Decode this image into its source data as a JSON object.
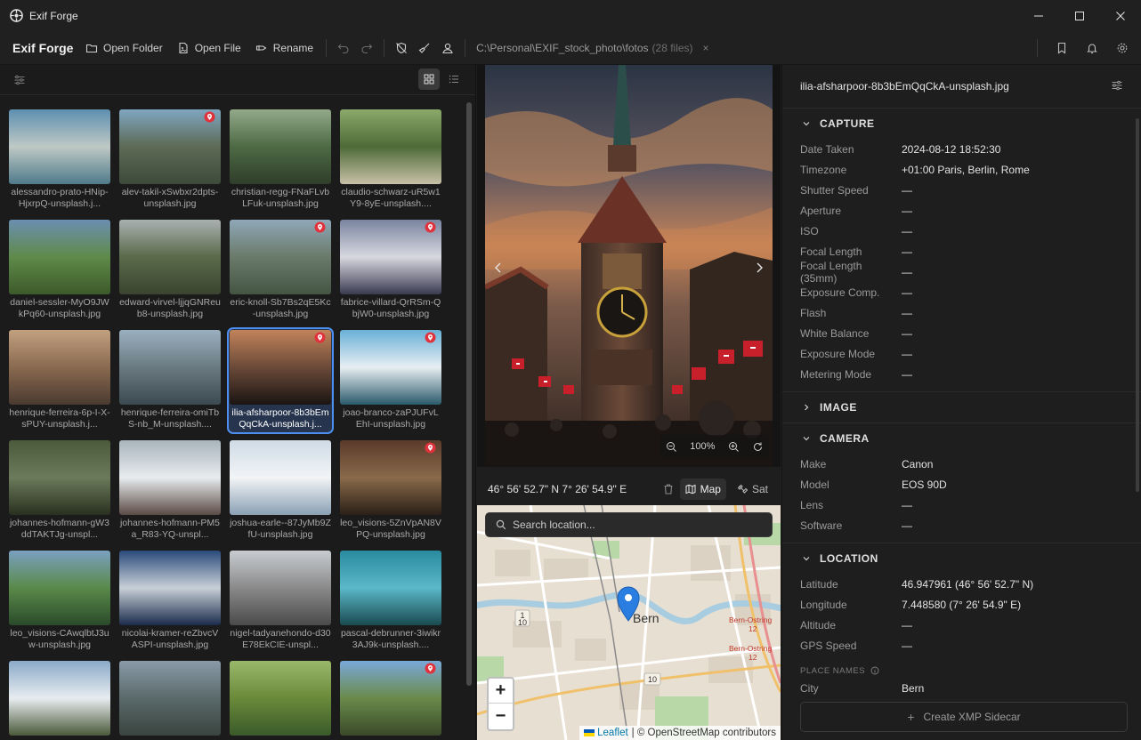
{
  "window": {
    "title": "Exif Forge"
  },
  "toolbar": {
    "brand": "Exif Forge",
    "open_folder": "Open Folder",
    "open_file": "Open File",
    "rename": "Rename",
    "path": "C:\\Personal\\EXIF_stock_photo\\fotos",
    "count": "(28 files)",
    "close_glyph": "×"
  },
  "grid": {
    "items": [
      {
        "name": "alessandro-prato-HNip-HjxrpQ-unsplash.j...",
        "pin": false
      },
      {
        "name": "alev-takil-xSwbxr2dpts-unsplash.jpg",
        "pin": true
      },
      {
        "name": "christian-regg-FNaFLvbLFuk-unsplash.jpg",
        "pin": false
      },
      {
        "name": "claudio-schwarz-uR5w1Y9-8yE-unsplash....",
        "pin": false
      },
      {
        "name": "daniel-sessler-MyO9JWkPq60-unsplash.jpg",
        "pin": false
      },
      {
        "name": "edward-virvel-ljjqGNReub8-unsplash.jpg",
        "pin": false
      },
      {
        "name": "eric-knoll-Sb7Bs2qE5Kc-unsplash.jpg",
        "pin": true
      },
      {
        "name": "fabrice-villard-QrRSm-QbjW0-unsplash.jpg",
        "pin": true
      },
      {
        "name": "henrique-ferreira-6p-I-X-sPUY-unsplash.j...",
        "pin": false
      },
      {
        "name": "henrique-ferreira-omiTbS-nb_M-unsplash....",
        "pin": false
      },
      {
        "name": "ilia-afsharpoor-8b3bEmQqCkA-unsplash.j...",
        "pin": true,
        "selected": true
      },
      {
        "name": "joao-branco-zaPJUFvLEhI-unsplash.jpg",
        "pin": true
      },
      {
        "name": "johannes-hofmann-gW3ddTAKTJg-unspl...",
        "pin": false
      },
      {
        "name": "johannes-hofmann-PM5a_R83-YQ-unspl...",
        "pin": false
      },
      {
        "name": "joshua-earle--87JyMb9ZfU-unsplash.jpg",
        "pin": false
      },
      {
        "name": "leo_visions-5ZnVpAN8VPQ-unsplash.jpg",
        "pin": true
      },
      {
        "name": "leo_visions-CAwqlbtJ3uw-unsplash.jpg",
        "pin": false
      },
      {
        "name": "nicolai-kramer-reZbvcVASPI-unsplash.jpg",
        "pin": false
      },
      {
        "name": "nigel-tadyanehondo-d30E78EkCIE-unspl...",
        "pin": false
      },
      {
        "name": "pascal-debrunner-3iwikr3AJ9k-unsplash....",
        "pin": false
      },
      {
        "name": "",
        "pin": false
      },
      {
        "name": "",
        "pin": false
      },
      {
        "name": "",
        "pin": false
      },
      {
        "name": "",
        "pin": true
      }
    ]
  },
  "viewer": {
    "zoom": "100%"
  },
  "coords": {
    "text": "46° 56' 52.7\" N 7° 26' 54.9\" E",
    "map_label": "Map",
    "sat_label": "Sat"
  },
  "map": {
    "search_placeholder": "Search location...",
    "city_label": "Bern",
    "zoom_in": "+",
    "zoom_out": "−",
    "leaflet": "Leaflet",
    "attribution": "| © OpenStreetMap contributors",
    "road_labels": [
      "1",
      "10",
      "10",
      "Bern-Ostring",
      "Bern-Ostring",
      "12",
      "12"
    ]
  },
  "details": {
    "filename": "ilia-afsharpoor-8b3bEmQqCkA-unsplash.jpg",
    "capture": {
      "title": "CAPTURE",
      "rows": [
        {
          "k": "Date Taken",
          "v": "2024-08-12  18:52:30"
        },
        {
          "k": "Timezone",
          "v": "+01:00 Paris, Berlin, Rome"
        },
        {
          "k": "Shutter Speed",
          "v": "—"
        },
        {
          "k": "Aperture",
          "v": "—"
        },
        {
          "k": "ISO",
          "v": "—"
        },
        {
          "k": "Focal Length",
          "v": "—"
        },
        {
          "k": "Focal Length (35mm)",
          "v": "—"
        },
        {
          "k": "Exposure Comp.",
          "v": "—"
        },
        {
          "k": "Flash",
          "v": "—"
        },
        {
          "k": "White Balance",
          "v": "—"
        },
        {
          "k": "Exposure Mode",
          "v": "—"
        },
        {
          "k": "Metering Mode",
          "v": "—"
        }
      ]
    },
    "image": {
      "title": "IMAGE"
    },
    "camera": {
      "title": "CAMERA",
      "rows": [
        {
          "k": "Make",
          "v": "Canon"
        },
        {
          "k": "Model",
          "v": "EOS 90D"
        },
        {
          "k": "Lens",
          "v": "—"
        },
        {
          "k": "Software",
          "v": "—"
        }
      ]
    },
    "location": {
      "title": "LOCATION",
      "rows": [
        {
          "k": "Latitude",
          "v": "46.947961  (46° 56' 52.7\" N)"
        },
        {
          "k": "Longitude",
          "v": "7.448580  (7° 26' 54.9\" E)"
        },
        {
          "k": "Altitude",
          "v": "—"
        },
        {
          "k": "GPS Speed",
          "v": "—"
        }
      ],
      "place_names": "PLACE NAMES",
      "city_k": "City",
      "city_v": "Bern"
    },
    "xmp_button": "Create XMP Sidecar"
  },
  "colors": {
    "accent": "#4d8ff0",
    "pin": "#e0323c",
    "map_pin": "#2a7de1"
  }
}
